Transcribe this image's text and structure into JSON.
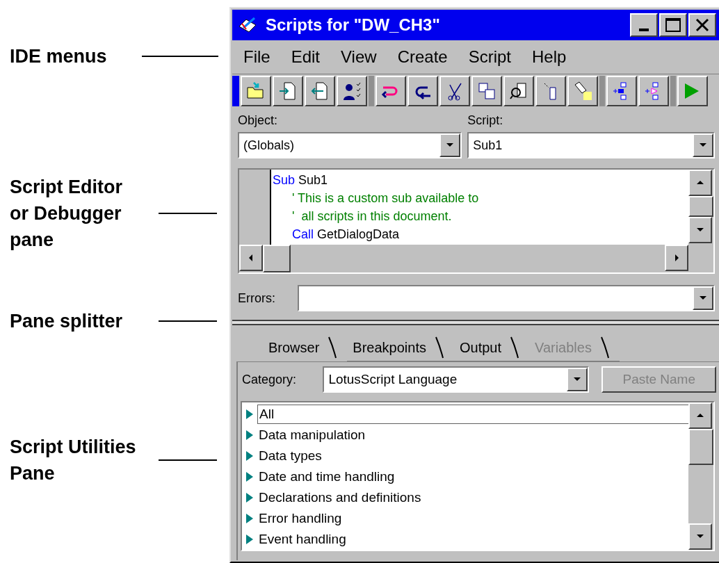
{
  "callouts": [
    {
      "lines": [
        "IDE menus"
      ]
    },
    {
      "lines": [
        "Script Editor",
        "or Debugger",
        "pane"
      ]
    },
    {
      "lines": [
        "Pane splitter"
      ]
    },
    {
      "lines": [
        "Script Utilities",
        "Pane"
      ]
    }
  ],
  "window": {
    "title": "Scripts for \"DW_CH3\""
  },
  "menu": [
    {
      "label": "File"
    },
    {
      "label": "Edit"
    },
    {
      "label": "View"
    },
    {
      "label": "Create"
    },
    {
      "label": "Script"
    },
    {
      "label": "Help"
    }
  ],
  "object": {
    "label": "Object:",
    "value": "(Globals)"
  },
  "script": {
    "label": "Script:",
    "value": "Sub1"
  },
  "editor": {
    "lines": [
      {
        "indent": false,
        "segments": [
          {
            "kind": "keyword",
            "text": "Sub"
          },
          {
            "kind": "text",
            "text": " Sub1"
          }
        ]
      },
      {
        "indent": true,
        "segments": [
          {
            "kind": "comment",
            "text": "' This is a custom sub available to"
          }
        ]
      },
      {
        "indent": true,
        "segments": [
          {
            "kind": "comment",
            "text": "'  all scripts in this document."
          }
        ]
      },
      {
        "indent": true,
        "segments": [
          {
            "kind": "keyword",
            "text": "Call"
          },
          {
            "kind": "text",
            "text": " GetDialogData"
          }
        ]
      }
    ]
  },
  "errors": {
    "label": "Errors:"
  },
  "tabs": [
    {
      "label": "Browser",
      "selected": true,
      "disabled": false
    },
    {
      "label": "Breakpoints",
      "selected": false,
      "disabled": false
    },
    {
      "label": "Output",
      "selected": false,
      "disabled": false
    },
    {
      "label": "Variables",
      "selected": false,
      "disabled": true
    }
  ],
  "category": {
    "label": "Category:",
    "value": "LotusScript Language"
  },
  "paste_button": {
    "label": "Paste Name",
    "disabled": true
  },
  "items": [
    {
      "label": "All",
      "focused": true
    },
    {
      "label": "Data manipulation",
      "focused": false
    },
    {
      "label": "Data types",
      "focused": false
    },
    {
      "label": "Date and time handling",
      "focused": false
    },
    {
      "label": "Declarations and definitions",
      "focused": false
    },
    {
      "label": "Error handling",
      "focused": false
    },
    {
      "label": "Event handling",
      "focused": false
    }
  ]
}
